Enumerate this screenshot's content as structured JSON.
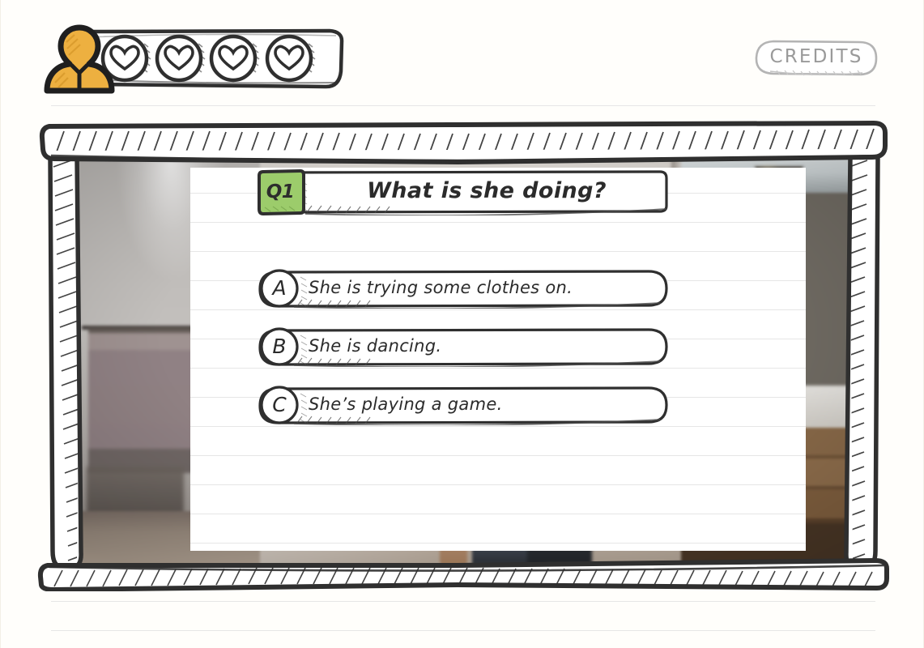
{
  "header": {
    "avatar": {
      "icon": "user-avatar-icon",
      "color": "#edb040"
    },
    "lives": {
      "icon": "heart-icon",
      "total": 4,
      "filled": 0,
      "items": [
        {
          "state": "empty"
        },
        {
          "state": "empty"
        },
        {
          "state": "empty"
        },
        {
          "state": "empty"
        }
      ]
    },
    "credits_button": {
      "label": "CREDITS"
    }
  },
  "quiz": {
    "question": {
      "badge": "Q1",
      "badge_color": "#9ccc6b",
      "text": "What is she doing?"
    },
    "answers": [
      {
        "letter": "A",
        "text": "She is trying some clothes on."
      },
      {
        "letter": "B",
        "text": "She is dancing."
      },
      {
        "letter": "C",
        "text": "She’s playing a game."
      }
    ]
  },
  "video": {
    "scene": "clothing-store-interior",
    "description": "Blurred retail clothing store with garment rack, window and wooden counter"
  },
  "colors": {
    "page_background": "#fffefb",
    "ink": "#2b2b2b",
    "rule_line": "#e6e6e6",
    "accent_green": "#9ccc6b",
    "accent_orange": "#edb040",
    "muted_gray": "#9a9a9a"
  }
}
